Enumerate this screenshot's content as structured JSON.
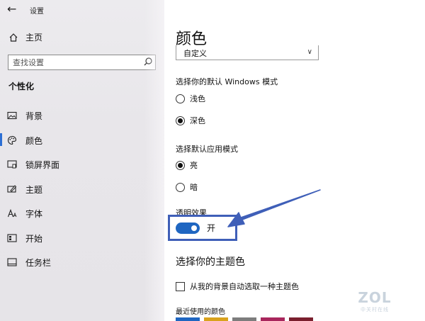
{
  "window": {
    "title": "设置",
    "back_icon": "back-arrow-icon"
  },
  "sidebar": {
    "home_label": "主页",
    "search_placeholder": "查找设置",
    "section_title": "个性化",
    "items": [
      {
        "label": "背景",
        "icon": "picture-icon"
      },
      {
        "label": "颜色",
        "icon": "palette-icon",
        "active": true
      },
      {
        "label": "锁屏界面",
        "icon": "lock-screen-icon"
      },
      {
        "label": "主题",
        "icon": "theme-icon"
      },
      {
        "label": "字体",
        "icon": "font-icon"
      },
      {
        "label": "开始",
        "icon": "start-icon"
      },
      {
        "label": "任务栏",
        "icon": "taskbar-icon"
      }
    ]
  },
  "main": {
    "title": "颜色",
    "color_dropdown_value": "自定义",
    "windows_mode_label": "选择你的默认 Windows 模式",
    "windows_mode_options": [
      {
        "label": "浅色",
        "selected": false
      },
      {
        "label": "深色",
        "selected": true
      }
    ],
    "app_mode_label": "选择默认应用模式",
    "app_mode_options": [
      {
        "label": "亮",
        "selected": true
      },
      {
        "label": "暗",
        "selected": false
      }
    ],
    "transparency_label": "透明效果",
    "transparency_state": "开",
    "accent_heading": "选择你的主题色",
    "auto_accent_label": "从我的背景自动选取一种主题色",
    "recent_colors_label": "最近使用的颜色",
    "recent_colors": [
      "#1f66c1",
      "#d9a21c",
      "#7d7d7d",
      "#a8265c",
      "#7a1f2e"
    ]
  },
  "colors": {
    "accent": "#1f66c1",
    "annotation": "#3f5fb8"
  },
  "watermark": {
    "logo": "ZOL",
    "sub": "中关村在线"
  }
}
